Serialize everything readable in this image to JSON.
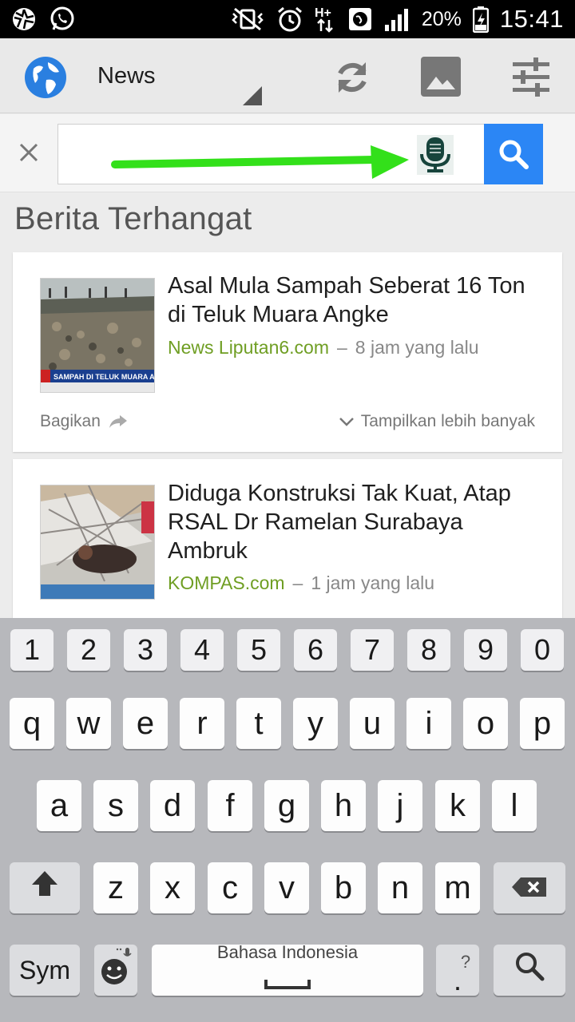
{
  "status_bar": {
    "battery_percent": "20%",
    "time": "15:41",
    "network": "H+"
  },
  "app_bar": {
    "title": "News",
    "icons": [
      "globe-icon",
      "refresh-icon",
      "image-icon",
      "tune-icon"
    ]
  },
  "search": {
    "value": "",
    "icons": [
      "close-icon",
      "microphone-icon",
      "search-icon"
    ],
    "accent": "#2b86f5",
    "annotation_arrow_color": "#33e01a"
  },
  "section_title": "Berita Terhangat",
  "articles": [
    {
      "headline": "Asal Mula Sampah Seberat 16 Ton di Teluk Muara Angke",
      "source": "News Liputan6.com",
      "separator": "–",
      "time": "8 jam yang lalu",
      "share_label": "Bagikan",
      "more_label": "Tampilkan lebih banyak",
      "thumb_caption": "SAMPAH DI TELUK MUARA A"
    },
    {
      "headline": "Diduga Konstruksi Tak Kuat, Atap RSAL Dr Ramelan Surabaya Ambruk",
      "source": "KOMPAS.com",
      "separator": "–",
      "time": "1 jam yang lalu"
    }
  ],
  "keyboard": {
    "numbers": [
      "1",
      "2",
      "3",
      "4",
      "5",
      "6",
      "7",
      "8",
      "9",
      "0"
    ],
    "row_q": [
      "q",
      "w",
      "e",
      "r",
      "t",
      "y",
      "u",
      "i",
      "o",
      "p"
    ],
    "row_a": [
      "a",
      "s",
      "d",
      "f",
      "g",
      "h",
      "j",
      "k",
      "l"
    ],
    "row_z": [
      "z",
      "x",
      "c",
      "v",
      "b",
      "n",
      "m"
    ],
    "sym_label": "Sym",
    "space_label": "Bahasa Indonesia",
    "period_label": ".",
    "period_hint": "?"
  },
  "source_color": "#6f9e23"
}
